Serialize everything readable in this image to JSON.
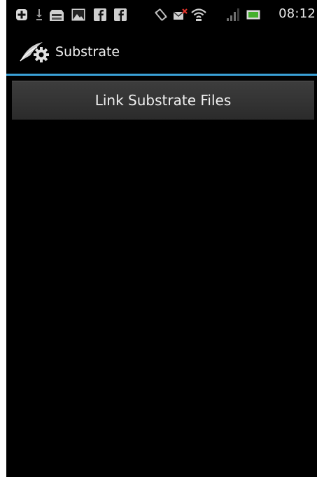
{
  "status_bar": {
    "time": "08:12",
    "icons": [
      "plus-icon",
      "download-icon",
      "sd-card-icon",
      "image-icon",
      "facebook-icon",
      "facebook-icon",
      "vibrate-icon",
      "mail-error-icon",
      "wifi-icon",
      "signal-icon",
      "battery-icon"
    ]
  },
  "action_bar": {
    "title": "Substrate"
  },
  "main": {
    "link_button_label": "Link Substrate Files"
  },
  "colors": {
    "background": "#000000",
    "accent": "#3aa0d6",
    "button": "#333333",
    "text": "#f0f0f0"
  }
}
